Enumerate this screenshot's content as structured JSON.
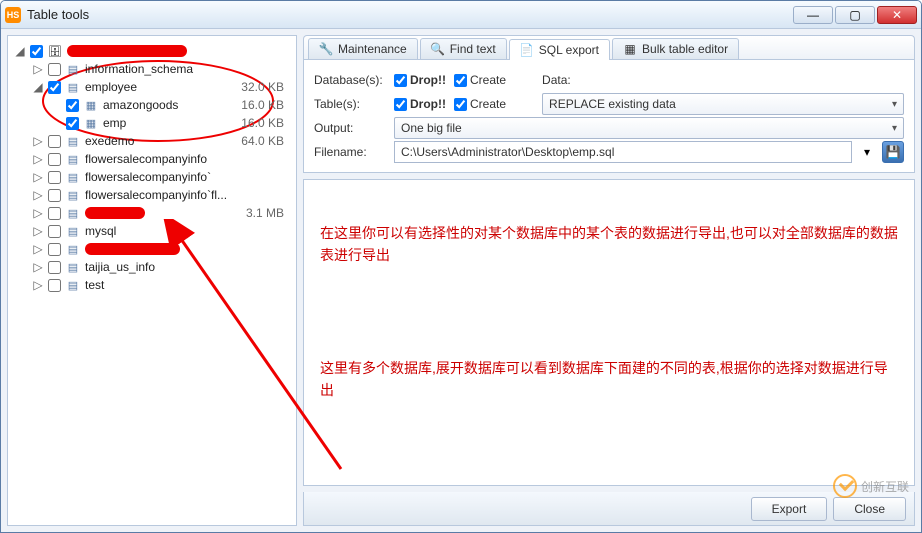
{
  "window": {
    "title": "Table tools",
    "app_icon_text": "HS"
  },
  "win_buttons": {
    "min": "—",
    "max": "▢",
    "close": "✕"
  },
  "tree": {
    "root_redacted_width": 120,
    "items": [
      {
        "expander": "▷",
        "depth": 1,
        "checked": false,
        "icon": "db",
        "label": "information_schema",
        "size": ""
      },
      {
        "expander": "◢",
        "depth": 1,
        "checked": true,
        "icon": "db",
        "label": "employee",
        "size": "32.0 KB"
      },
      {
        "expander": "",
        "depth": 2,
        "checked": true,
        "icon": "tbl",
        "label": "amazongoods",
        "size": "16.0 KB"
      },
      {
        "expander": "",
        "depth": 2,
        "checked": true,
        "icon": "tbl",
        "label": "emp",
        "size": "16.0 KB"
      },
      {
        "expander": "▷",
        "depth": 1,
        "checked": false,
        "icon": "db",
        "label": "exedemo",
        "size": "64.0 KB"
      },
      {
        "expander": "▷",
        "depth": 1,
        "checked": false,
        "icon": "db",
        "label": "flowersalecompanyinfo",
        "size": ""
      },
      {
        "expander": "▷",
        "depth": 1,
        "checked": false,
        "icon": "db",
        "label": "flowersalecompanyinfo`",
        "size": ""
      },
      {
        "expander": "▷",
        "depth": 1,
        "checked": false,
        "icon": "db",
        "label": "flowersalecompanyinfo`fl...",
        "size": ""
      },
      {
        "expander": "▷",
        "depth": 1,
        "checked": false,
        "icon": "db",
        "redacted": true,
        "redacted_width": 60,
        "size": "3.1 MB"
      },
      {
        "expander": "▷",
        "depth": 1,
        "checked": false,
        "icon": "db",
        "label": "mysql",
        "size": ""
      },
      {
        "expander": "▷",
        "depth": 1,
        "checked": false,
        "icon": "db",
        "redacted": true,
        "redacted_width": 95,
        "size": ""
      },
      {
        "expander": "▷",
        "depth": 1,
        "checked": false,
        "icon": "db",
        "label": "taijia_us_info",
        "size": ""
      },
      {
        "expander": "▷",
        "depth": 1,
        "checked": false,
        "icon": "db",
        "label": "test",
        "size": ""
      }
    ]
  },
  "tabs": [
    {
      "icon": "🔧",
      "label": "Maintenance",
      "active": false
    },
    {
      "icon": "🔍",
      "label": "Find text",
      "active": false
    },
    {
      "icon": "📄",
      "label": "SQL export",
      "active": true
    },
    {
      "icon": "▦",
      "label": "Bulk table editor",
      "active": false
    }
  ],
  "options": {
    "database_label": "Database(s):",
    "table_label": "Table(s):",
    "output_label": "Output:",
    "filename_label": "Filename:",
    "data_label": "Data:",
    "drop_label": "Drop!!",
    "create_label": "Create",
    "db_drop_checked": true,
    "db_create_checked": true,
    "tbl_drop_checked": true,
    "tbl_create_checked": true,
    "data_dropdown": "REPLACE existing data",
    "output_dropdown": "One big file",
    "filename_value": "C:\\Users\\Administrator\\Desktop\\emp.sql"
  },
  "annotations": {
    "a1": "在这里你可以有选择性的对某个数据库中的某个表的数据进行导出,也可以对全部数据库的数据表进行导出",
    "a2": "这里有多个数据库,展开数据库可以看到数据库下面建的不同的表,根据你的选择对数据进行导出"
  },
  "footer": {
    "export": "Export",
    "close": "Close"
  },
  "watermark": "创新互联"
}
